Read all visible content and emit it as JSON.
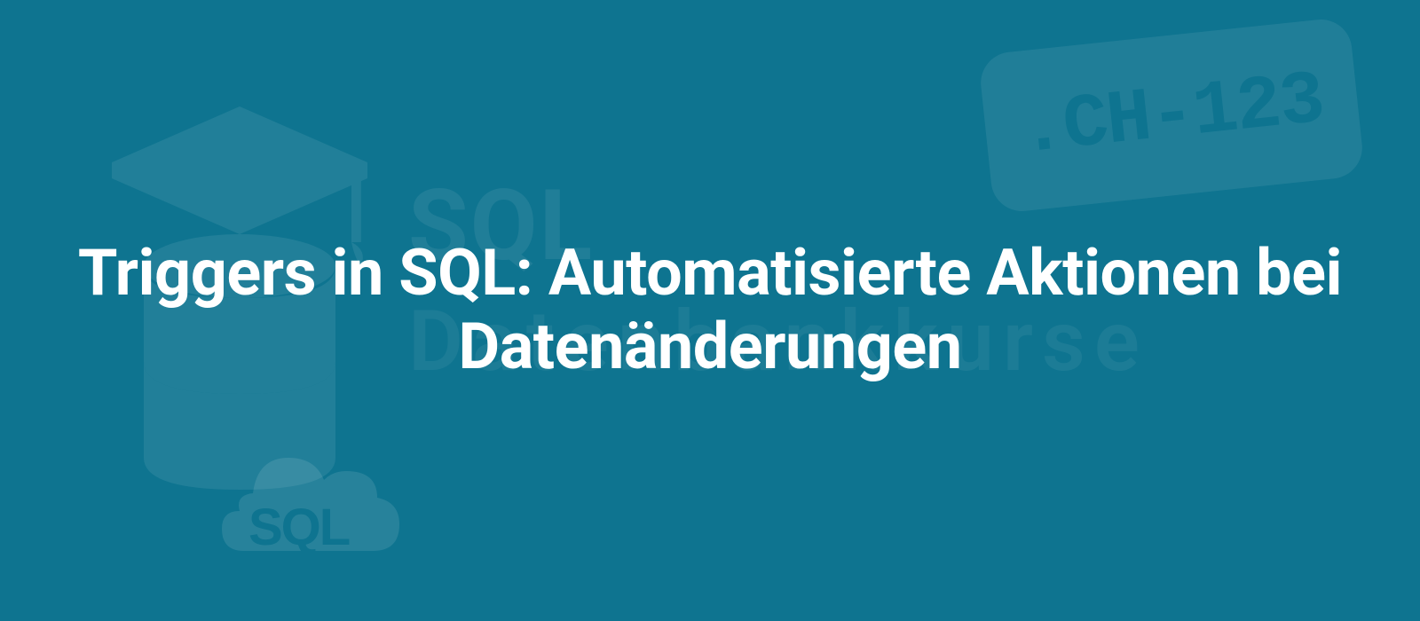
{
  "title": "Triggers in SQL: Automatisierte Aktionen bei Datenänderungen",
  "watermarks": {
    "sql_label": "SQL",
    "sub_label": "Datenbankkurse",
    "badge_text": ".CH-123",
    "cloud_text": "SQL"
  }
}
